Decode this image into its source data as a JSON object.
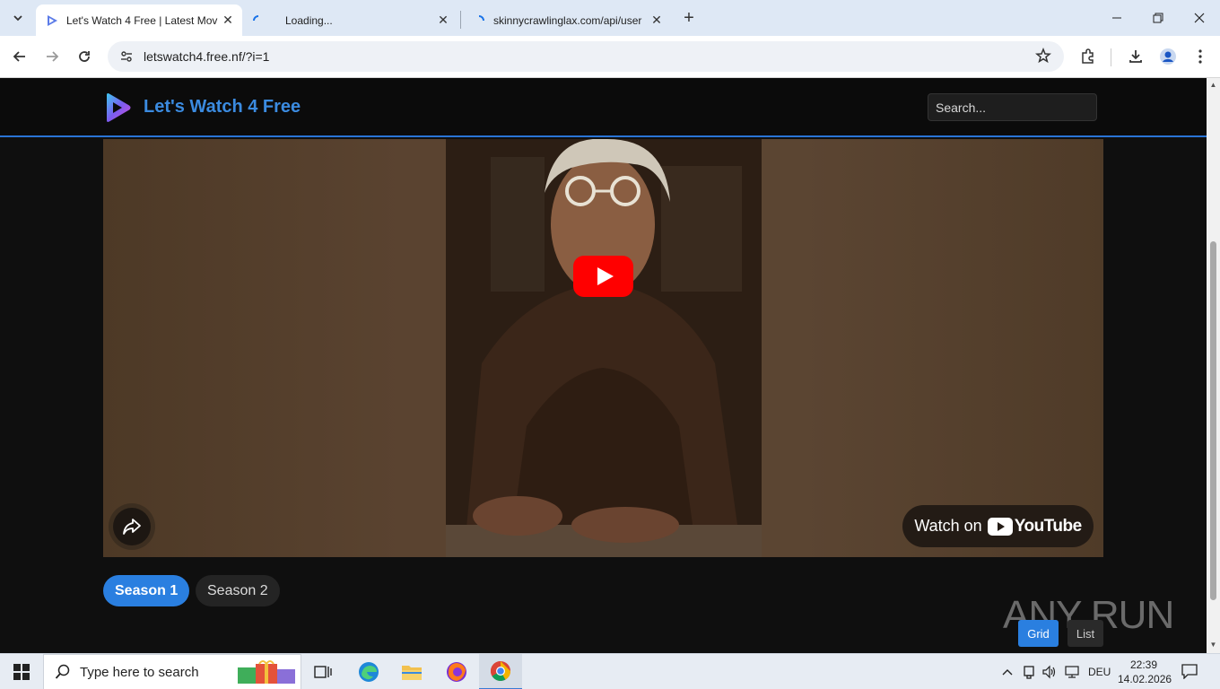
{
  "browser": {
    "tabs": [
      {
        "title": "Let's Watch 4 Free | Latest Mov",
        "active": true
      },
      {
        "title": "Loading...",
        "active": false
      },
      {
        "title": "skinnycrawlinglax.com/api/user",
        "active": false
      }
    ],
    "url": "letswatch4.free.nf/?i=1"
  },
  "site": {
    "name": "Let's Watch 4 Free",
    "search_placeholder": "Search...",
    "brand_color": "#3b8be0"
  },
  "player": {
    "watch_on": "Watch on",
    "youtube_label": "YouTube"
  },
  "seasons": [
    {
      "label": "Season 1",
      "active": true
    },
    {
      "label": "Season 2",
      "active": false
    }
  ],
  "view_toggle": {
    "grid_label": "Grid",
    "list_label": "List"
  },
  "watermark": "ANY RUN",
  "taskbar": {
    "search_text": "Type here to search",
    "language": "DEU",
    "time": "22:39",
    "date": "14.02.2026"
  }
}
